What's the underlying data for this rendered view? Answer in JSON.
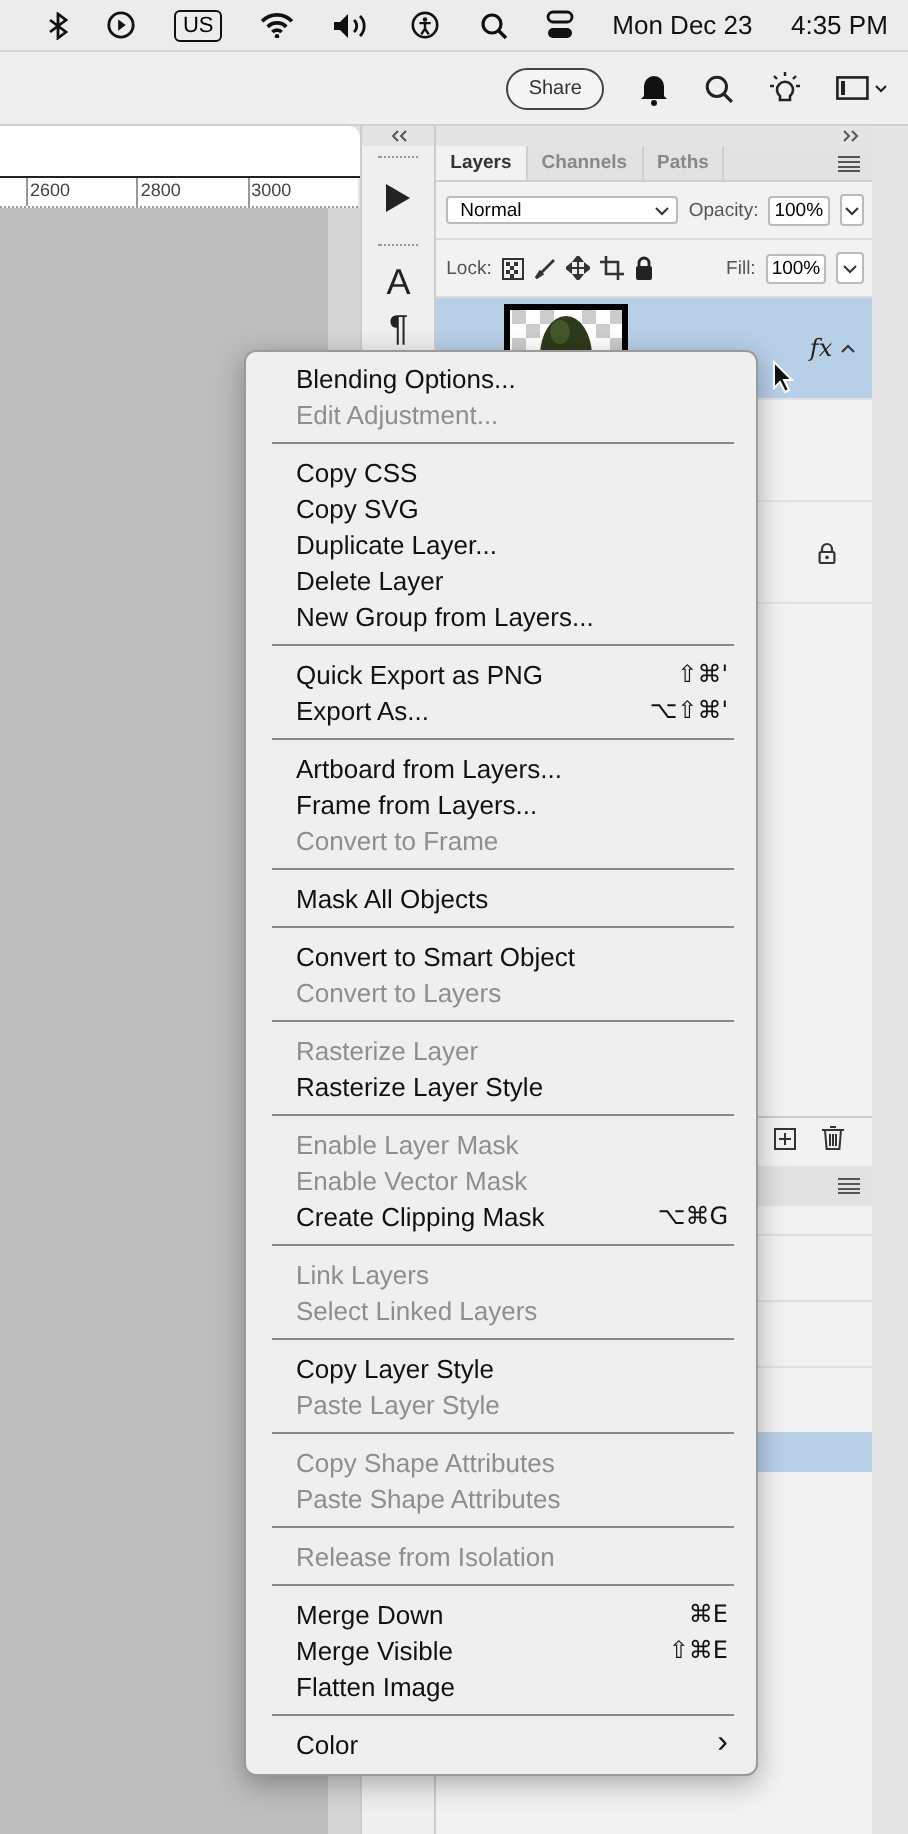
{
  "menu_bar": {
    "keyboard": "US",
    "date": "Mon Dec 23",
    "time": "4:35 PM"
  },
  "app_bar": {
    "share": "Share"
  },
  "ruler": {
    "ticks": [
      "2600",
      "2800",
      "3000"
    ]
  },
  "tools": [
    {
      "kind": "play"
    },
    {
      "kind": "glyph",
      "glyph": "A"
    },
    {
      "kind": "glyph",
      "glyph": "¶"
    }
  ],
  "layers_panel": {
    "tabs": [
      {
        "label": "Layers",
        "selected": true
      },
      {
        "label": "Channels",
        "selected": false
      },
      {
        "label": "Paths",
        "selected": false
      }
    ],
    "blend_mode": "Normal",
    "opacity_label": "Opacity:",
    "opacity": "100%",
    "lock_label": "Lock:",
    "fill_label": "Fill:",
    "fill": "100%",
    "layers": [
      {
        "selected": true,
        "thumbnail": true,
        "fx": "fx"
      },
      {
        "selected": false
      },
      {
        "selected": false,
        "locked": true
      }
    ]
  },
  "lower_panel": {
    "rows": [
      {
        "selected": false
      },
      {
        "selected": false
      },
      {
        "selected": false
      },
      {
        "selected": true
      }
    ]
  },
  "context_menu": {
    "groups": [
      [
        {
          "label": "Blending Options...",
          "disabled": false
        },
        {
          "label": "Edit Adjustment...",
          "disabled": true
        }
      ],
      [
        {
          "label": "Copy CSS",
          "disabled": false
        },
        {
          "label": "Copy SVG",
          "disabled": false
        },
        {
          "label": "Duplicate Layer...",
          "disabled": false
        },
        {
          "label": "Delete Layer",
          "disabled": false
        },
        {
          "label": "New Group from Layers...",
          "disabled": false
        }
      ],
      [
        {
          "label": "Quick Export as PNG",
          "shortcut": "⇧⌘'",
          "disabled": false
        },
        {
          "label": "Export As...",
          "shortcut": "⌥⇧⌘'",
          "disabled": false
        }
      ],
      [
        {
          "label": "Artboard from Layers...",
          "disabled": false
        },
        {
          "label": "Frame from Layers...",
          "disabled": false
        },
        {
          "label": "Convert to Frame",
          "disabled": true
        }
      ],
      [
        {
          "label": "Mask All Objects",
          "disabled": false
        }
      ],
      [
        {
          "label": "Convert to Smart Object",
          "disabled": false
        },
        {
          "label": "Convert to Layers",
          "disabled": true
        }
      ],
      [
        {
          "label": "Rasterize Layer",
          "disabled": true
        },
        {
          "label": "Rasterize Layer Style",
          "disabled": false
        }
      ],
      [
        {
          "label": "Enable Layer Mask",
          "disabled": true
        },
        {
          "label": "Enable Vector Mask",
          "disabled": true
        },
        {
          "label": "Create Clipping Mask",
          "shortcut": "⌥⌘G",
          "disabled": false
        }
      ],
      [
        {
          "label": "Link Layers",
          "disabled": true
        },
        {
          "label": "Select Linked Layers",
          "disabled": true
        }
      ],
      [
        {
          "label": "Copy Layer Style",
          "disabled": false
        },
        {
          "label": "Paste Layer Style",
          "disabled": true
        }
      ],
      [
        {
          "label": "Copy Shape Attributes",
          "disabled": true
        },
        {
          "label": "Paste Shape Attributes",
          "disabled": true
        }
      ],
      [
        {
          "label": "Release from Isolation",
          "disabled": true
        }
      ],
      [
        {
          "label": "Merge Down",
          "shortcut": "⌘E",
          "disabled": false
        },
        {
          "label": "Merge Visible",
          "shortcut": "⇧⌘E",
          "disabled": false
        },
        {
          "label": "Flatten Image",
          "disabled": false
        }
      ],
      [
        {
          "label": "Color",
          "arrow": "›",
          "disabled": false
        }
      ]
    ]
  }
}
